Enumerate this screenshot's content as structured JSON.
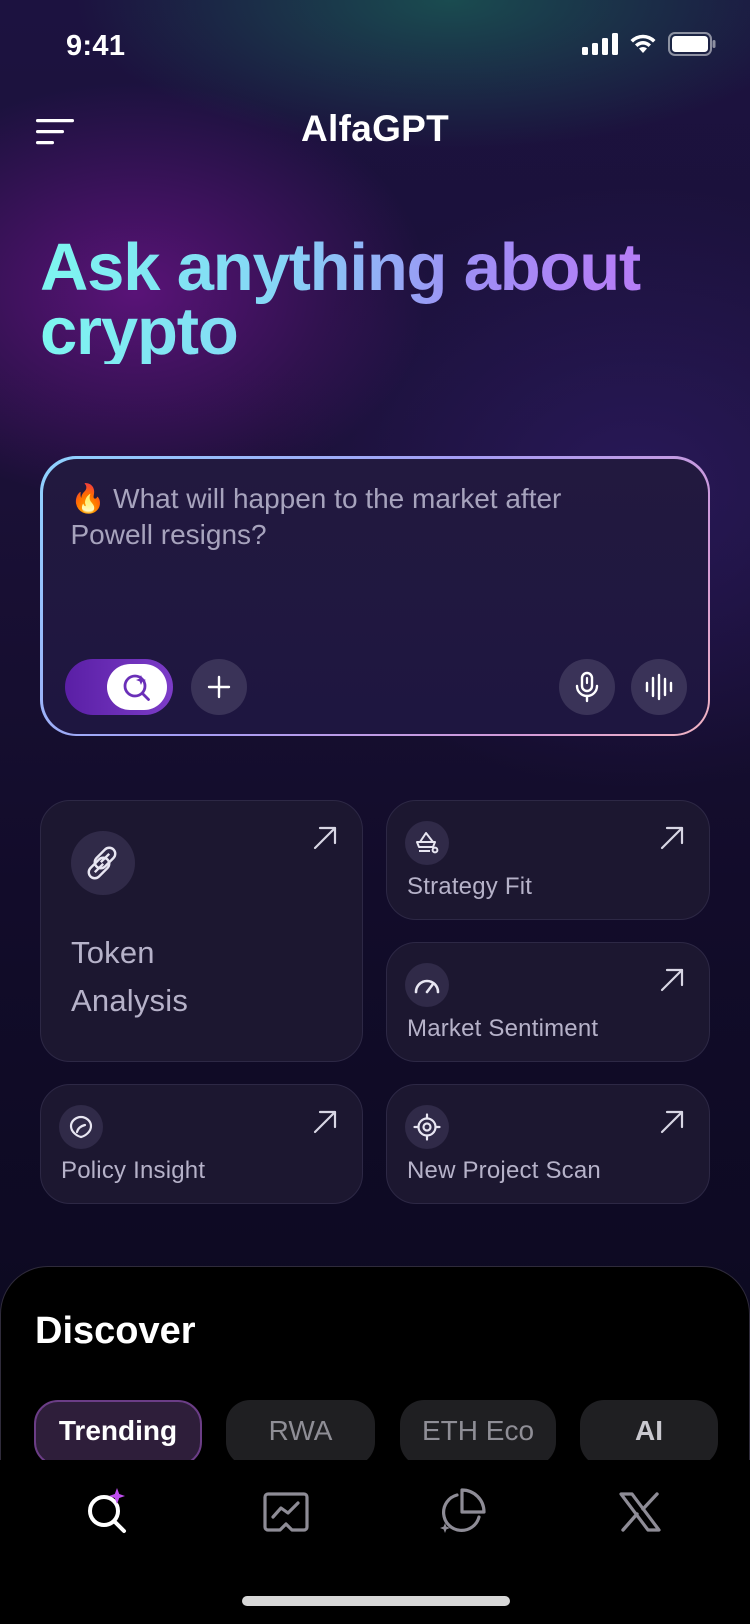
{
  "status_bar": {
    "time": "9:41"
  },
  "header": {
    "title": "AlfaGPT"
  },
  "hero": {
    "line1_part1": "Ask anything about",
    "line2": "crypto"
  },
  "input": {
    "emoji": "🔥",
    "placeholder": "What will happen to the market after Powell resigns?"
  },
  "actions": [
    {
      "label_line1": "Token",
      "label_line2": "Analysis",
      "icon": "pills-icon"
    },
    {
      "label": "Strategy Fit",
      "icon": "coin-stack-icon"
    },
    {
      "label": "Market Sentiment",
      "icon": "gauge-icon"
    },
    {
      "label": "Policy Insight",
      "icon": "shield-icon"
    },
    {
      "label": "New Project Scan",
      "icon": "target-icon"
    }
  ],
  "discover": {
    "title": "Discover",
    "chips": [
      "Trending",
      "RWA",
      "ETH Eco",
      "AI"
    ],
    "active_chip": "Trending"
  },
  "tabbar": {
    "tabs": [
      "search-sparkle-icon",
      "chart-icon",
      "pie-chart-icon",
      "x-logo-icon"
    ],
    "active_color": "#c04ef0"
  }
}
